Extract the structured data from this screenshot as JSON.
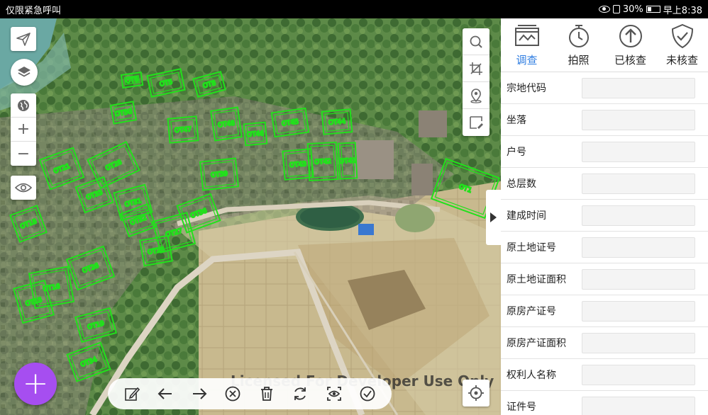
{
  "status_bar": {
    "emergency_text": "仅限紧急呼叫",
    "battery_percent": "30%",
    "time": "早上8:38",
    "battery_level": 0.3
  },
  "map": {
    "watermark": "Licensed For Developer Use Only",
    "left_tools": [
      "send-icon",
      "layers-icon",
      "globe-icon",
      "zoom-in-icon",
      "zoom-out-icon",
      "eye-icon"
    ],
    "zoom_in_label": "+",
    "zoom_out_label": "−",
    "right_tools": [
      "search-icon",
      "crop-icon",
      "location-pin-icon",
      "draw-polygon-icon"
    ],
    "bottom_tools": [
      "edit-icon",
      "undo-arrow-icon",
      "redo-arrow-icon",
      "cancel-icon",
      "delete-icon",
      "refresh-icon",
      "preview-icon",
      "confirm-icon"
    ],
    "fab_label": "+",
    "parcel_labels": [
      {
        "text": "OT6"
      },
      {
        "text": "OT5"
      },
      {
        "text": "OT8"
      },
      {
        "text": "OT50"
      },
      {
        "text": "OT47"
      },
      {
        "text": "OT48"
      },
      {
        "text": "OT46"
      },
      {
        "text": "OT45"
      },
      {
        "text": "OT44"
      },
      {
        "text": "OT39"
      },
      {
        "text": "OT41"
      },
      {
        "text": "OT28"
      },
      {
        "text": "OT33"
      },
      {
        "text": "OT21"
      },
      {
        "text": "OT31"
      },
      {
        "text": "OT32"
      },
      {
        "text": "OT27"
      },
      {
        "text": "OT25"
      },
      {
        "text": "OT18"
      },
      {
        "text": "OT19"
      },
      {
        "text": "OT36"
      },
      {
        "text": "OT26"
      },
      {
        "text": "OT15"
      },
      {
        "text": "OT16"
      },
      {
        "text": "OT34"
      },
      {
        "text": "OT43"
      },
      {
        "text": "OT42"
      },
      {
        "text": "OT1"
      }
    ],
    "colors": {
      "parcel_outline": "#22e01c",
      "fab": "#a64ef0"
    }
  },
  "panel": {
    "tabs": [
      {
        "label": "调查",
        "icon": "survey-icon",
        "active": true
      },
      {
        "label": "拍照",
        "icon": "timer-camera-icon",
        "active": false
      },
      {
        "label": "已核查",
        "icon": "upload-checked-icon",
        "active": false
      },
      {
        "label": "未核查",
        "icon": "shield-check-icon",
        "active": false
      }
    ],
    "fields": [
      {
        "label": "宗地代码",
        "value": ""
      },
      {
        "label": "坐落",
        "value": ""
      },
      {
        "label": "户号",
        "value": ""
      },
      {
        "label": "总层数",
        "value": ""
      },
      {
        "label": "建成时间",
        "value": ""
      },
      {
        "label": "原土地证号",
        "value": ""
      },
      {
        "label": "原土地证面积",
        "value": ""
      },
      {
        "label": "原房产证号",
        "value": ""
      },
      {
        "label": "原房产证面积",
        "value": ""
      },
      {
        "label": "权利人名称",
        "value": ""
      },
      {
        "label": "证件号",
        "value": ""
      }
    ],
    "colors": {
      "active_tab": "#2f7de1"
    }
  }
}
